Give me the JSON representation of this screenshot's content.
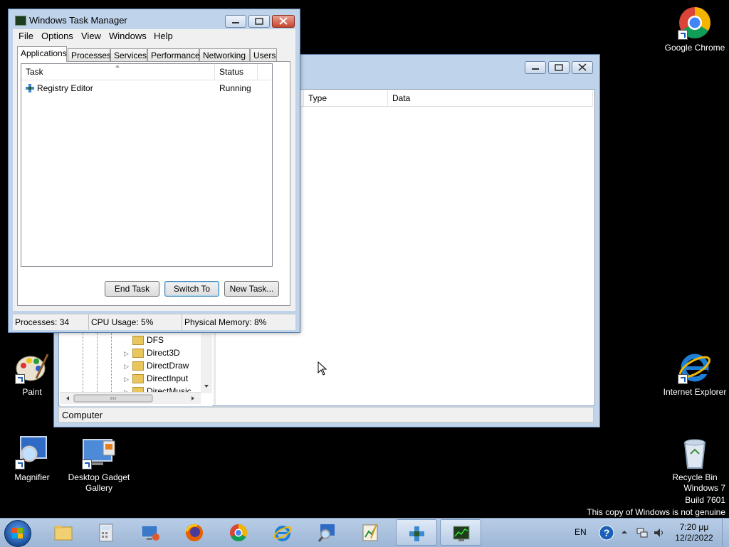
{
  "desktop": {
    "icons": [
      {
        "label": "Google Chrome"
      },
      {
        "label": "Paint"
      },
      {
        "label": "Internet Explorer"
      },
      {
        "label": "Magnifier"
      },
      {
        "label": "Desktop Gadget Gallery"
      },
      {
        "label": "Recycle Bin"
      }
    ],
    "watermark": {
      "line1": "Windows 7",
      "line2": "Build 7601",
      "line3": "This copy of Windows is not genuine"
    }
  },
  "regedit": {
    "columns": [
      "Type",
      "Data"
    ],
    "tree_items": [
      "DFS",
      "Direct3D",
      "DirectDraw",
      "DirectInput",
      "DirectMusic"
    ],
    "status": "Computer"
  },
  "taskmgr": {
    "title": "Windows Task Manager",
    "menu": [
      "File",
      "Options",
      "View",
      "Windows",
      "Help"
    ],
    "tabs": [
      "Applications",
      "Processes",
      "Services",
      "Performance",
      "Networking",
      "Users"
    ],
    "active_tab": "Applications",
    "columns": {
      "task": "Task",
      "status": "Status"
    },
    "rows": [
      {
        "task": "Registry Editor",
        "status": "Running"
      }
    ],
    "buttons": {
      "end_task": "End Task",
      "switch_to": "Switch To",
      "new_task": "New Task..."
    },
    "statusbar": {
      "processes": "Processes: 34",
      "cpu": "CPU Usage: 5%",
      "memory": "Physical Memory: 8%"
    }
  },
  "taskbar": {
    "language": "EN",
    "time": "7:20 μμ",
    "date": "12/2/2022"
  },
  "colors": {
    "desktop_bg": "#000000",
    "taskbar": "#a9c0dd",
    "window_frame": "#bfd3ea",
    "close_button": "#c9452f"
  }
}
